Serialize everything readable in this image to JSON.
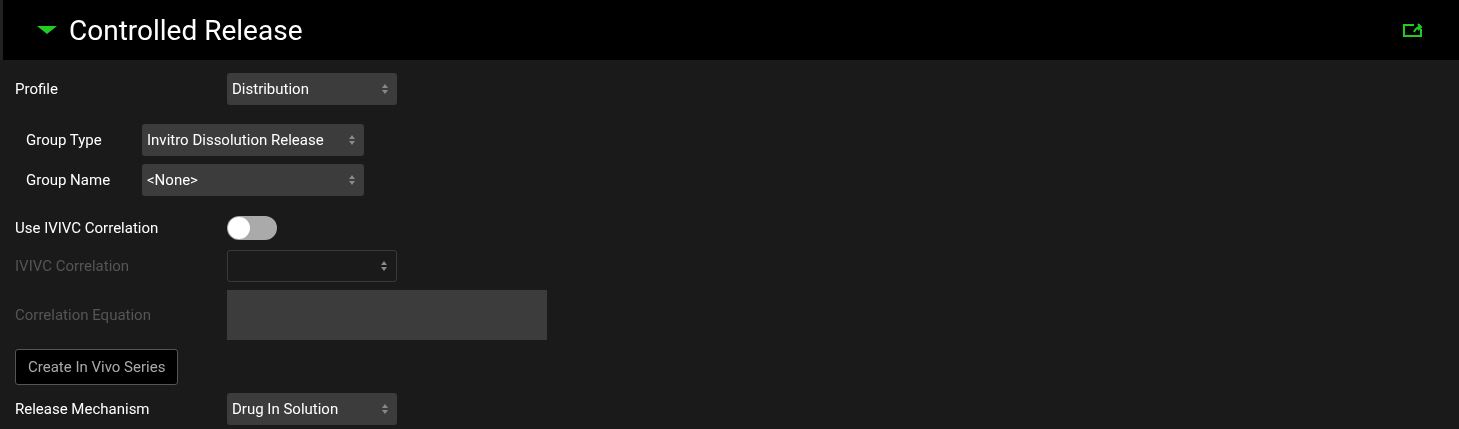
{
  "header": {
    "title": "Controlled Release",
    "expanded": true
  },
  "fields": [
    {
      "kind": "select",
      "label": "Profile",
      "value": "Distribution",
      "disabled": false
    },
    {
      "kind": "group",
      "children": [
        {
          "kind": "select",
          "label": "Group Type",
          "value": "Invitro Dissolution Release",
          "disabled": false
        },
        {
          "kind": "select",
          "label": "Group Name",
          "value": "<None>",
          "disabled": false
        }
      ]
    },
    {
      "kind": "toggle",
      "label": "Use IVIVC Correlation",
      "on": false,
      "disabled": false
    },
    {
      "kind": "select",
      "label": "IVIVC Correlation",
      "disabled": true
    },
    {
      "kind": "textarea",
      "label": "Correlation Equation",
      "disabled": true
    },
    {
      "kind": "button",
      "label": "Create In Vivo Series"
    },
    {
      "kind": "select",
      "label": "Release Mechanism",
      "value": "Drug In Solution",
      "disabled": false
    }
  ]
}
